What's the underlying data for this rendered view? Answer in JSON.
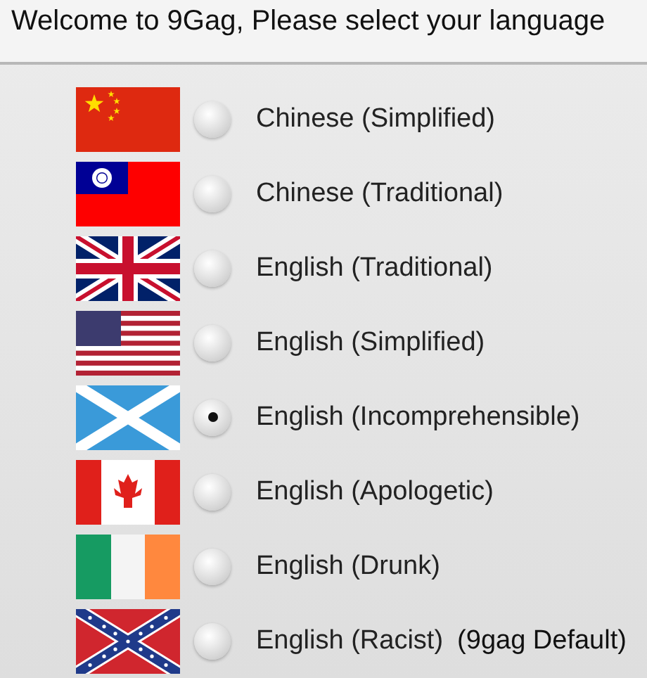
{
  "header": {
    "title": "Welcome to 9Gag, Please select your language"
  },
  "languages": [
    {
      "kind": "china",
      "label": "Chinese (Simplified)",
      "selected": false
    },
    {
      "kind": "taiwan",
      "label": "Chinese (Traditional)",
      "selected": false
    },
    {
      "kind": "uk",
      "label": "English (Traditional)",
      "selected": false
    },
    {
      "kind": "usa",
      "label": "English (Simplified)",
      "selected": false
    },
    {
      "kind": "scotland",
      "label": "English (Incomprehensible)",
      "selected": true
    },
    {
      "kind": "canada",
      "label": "English (Apologetic)",
      "selected": false
    },
    {
      "kind": "ireland",
      "label": "English (Drunk)",
      "selected": false
    },
    {
      "kind": "confederate",
      "label": "English (Racist)",
      "note": "(9gag Default)",
      "selected": false
    }
  ]
}
